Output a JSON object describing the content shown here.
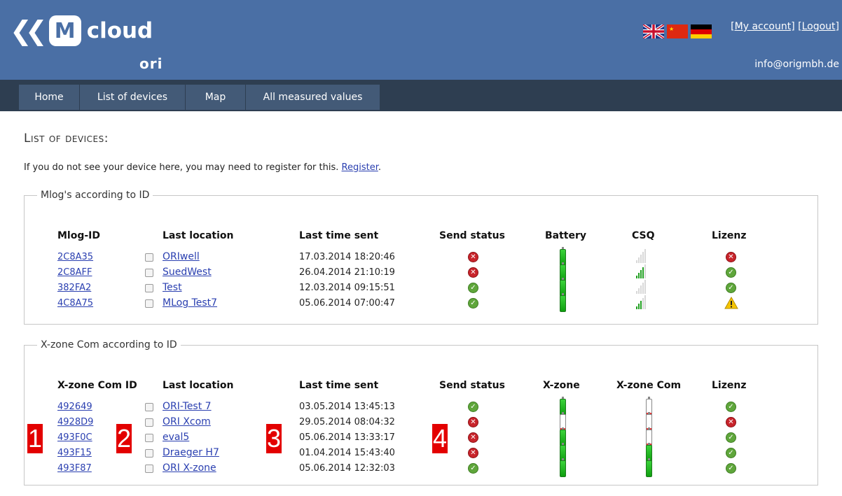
{
  "header": {
    "brand_cloud": "cloud",
    "brand_ori": "ori",
    "brand_m": "M",
    "links": [
      "[My account]",
      "[Logout]"
    ],
    "email": "info@origmbh.de",
    "flags": [
      "uk-flag-icon",
      "china-flag-icon",
      "germany-flag-icon"
    ]
  },
  "nav": {
    "tabs": [
      "Home",
      "List of devices",
      "Map",
      "All measured values"
    ]
  },
  "page": {
    "title": "List of devices:",
    "intro": "If you do not see your device here, you may need to register for this.",
    "register_link": "Register",
    "intro_end": "."
  },
  "mlog": {
    "legend": "Mlog's according to ID",
    "headers": [
      "Mlog-ID",
      "Last location",
      "Last time sent",
      "Send status",
      "Battery",
      "CSQ",
      "Lizenz"
    ],
    "rows": [
      {
        "id": "2C8A35",
        "location": "ORIwell",
        "time": "17.03.2014 18:20:46",
        "send_status": "error",
        "battery": "full",
        "csq": 0,
        "lizenz": "error"
      },
      {
        "id": "2C8AFF",
        "location": "SuedWest",
        "time": "26.04.2014 21:10:19",
        "send_status": "error",
        "battery": "full",
        "csq": 4,
        "lizenz": "ok"
      },
      {
        "id": "382FA2",
        "location": "Test",
        "time": "12.03.2014 09:15:51",
        "send_status": "ok",
        "battery": "full",
        "csq": 0,
        "lizenz": "ok"
      },
      {
        "id": "4C8A75",
        "location": "MLog Test7",
        "time": "05.06.2014 07:00:47",
        "send_status": "ok",
        "battery": "full",
        "csq": 3,
        "lizenz": "warning"
      }
    ]
  },
  "xzone": {
    "legend": "X-zone Com according to ID",
    "headers": [
      "X-zone Com ID",
      "Last location",
      "Last time sent",
      "Send status",
      "X-zone",
      "X-zone Com",
      "Lizenz"
    ],
    "rows": [
      {
        "id": "492649",
        "location": "ORI-Test 7",
        "time": "03.05.2014 13:45:13",
        "send_status": "ok",
        "xzone": "full",
        "xzone_com": "empty",
        "lizenz": "ok"
      },
      {
        "id": "4928D9",
        "location": "ORI Xcom",
        "time": "29.05.2014 08:04:32",
        "send_status": "error",
        "xzone": "empty",
        "xzone_com": "empty",
        "lizenz": "error"
      },
      {
        "id": "493F0C",
        "location": "eval5",
        "time": "05.06.2014 13:33:17",
        "send_status": "error",
        "xzone": "full",
        "xzone_com": "empty",
        "lizenz": "ok"
      },
      {
        "id": "493F15",
        "location": "Draeger H7",
        "time": "01.04.2014 15:43:40",
        "send_status": "error",
        "xzone": "full",
        "xzone_com": "full",
        "lizenz": "ok"
      },
      {
        "id": "493F87",
        "location": "ORI X-zone",
        "time": "05.06.2014 12:32:03",
        "send_status": "ok",
        "xzone": "full",
        "xzone_com": "full",
        "lizenz": "ok"
      }
    ]
  },
  "markers": [
    "1",
    "2",
    "3",
    "4"
  ],
  "colors": {
    "header": "#4a6fa5",
    "nav": "#2e3e51",
    "tab": "#435a77",
    "ok": "#5fa63b",
    "error": "#c8242b",
    "marker": "#e30000"
  }
}
